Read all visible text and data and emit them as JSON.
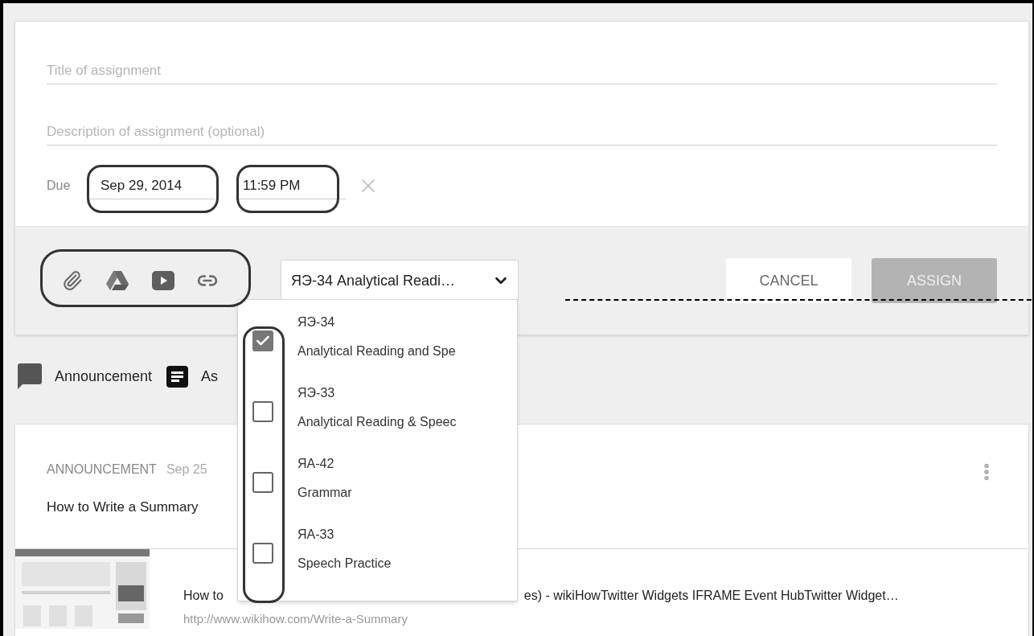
{
  "form": {
    "title_field": {
      "placeholder": "Title of assignment"
    },
    "description_field": {
      "placeholder": "Description of assignment (optional)"
    },
    "due": {
      "label": "Due",
      "date": "Sep 29, 2014",
      "time": "11:59 PM"
    }
  },
  "toolbar": {
    "attachments": [
      {
        "kind": "file"
      },
      {
        "kind": "drive"
      },
      {
        "kind": "video"
      },
      {
        "kind": "link"
      }
    ],
    "class_select": {
      "value": "ЯЭ-34 Analytical Readi…"
    },
    "buttons": [
      {
        "label": "CANCEL",
        "kind": "secondary",
        "disabled": false
      },
      {
        "label": "ASSIGN",
        "kind": "primary",
        "disabled": true
      }
    ]
  },
  "class_menu": [
    {
      "code": "ЯЭ-34",
      "name": "Analytical Reading and Spe",
      "checked": true
    },
    {
      "code": "ЯЭ-33",
      "name": "Analytical Reading & Speec",
      "checked": false
    },
    {
      "code": "ЯА-42",
      "name": "Grammar",
      "checked": false
    },
    {
      "code": "ЯА-33",
      "name": "Speech Practice",
      "checked": false
    }
  ],
  "post_types": [
    {
      "kind": "announcement",
      "label": "Announcement"
    },
    {
      "kind": "assignment",
      "label": "As"
    }
  ],
  "stream": [
    {
      "type_label": "ANNOUNCEMENT",
      "date": "Sep 25",
      "text": "How to Write a Summary",
      "attachment": {
        "kind": "picture",
        "title_start": "How to",
        "title_end": "es) - wikiHowTwitter Widgets IFRAME Event HubTwitter Widget…",
        "url": "http://www.wikihow.com/Write-a-Summary"
      }
    }
  ]
}
